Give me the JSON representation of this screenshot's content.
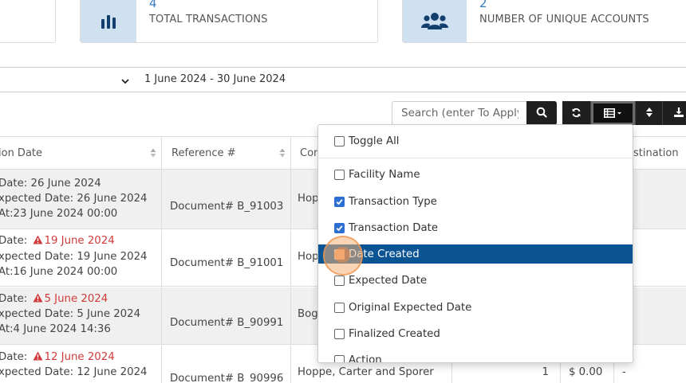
{
  "stats": {
    "transactions": {
      "value": "4",
      "label": "TOTAL TRANSACTIONS",
      "icon": "bar-chart-icon"
    },
    "accounts": {
      "value": "2",
      "label": "NUMBER OF UNIQUE ACCOUNTS",
      "icon": "users-icon"
    }
  },
  "filters": {
    "date_range": "1 June 2024 - 30 June 2024"
  },
  "toolbar": {
    "search_placeholder": "Search (enter To Apply)",
    "icons": [
      "search-icon",
      "refresh-icon",
      "columns-icon",
      "sort-icon",
      "download-icon"
    ]
  },
  "table": {
    "headers": {
      "date": "ion Date",
      "ref": "Reference #",
      "company": "Con",
      "destination": "estination"
    },
    "rows": [
      {
        "line1_prefix": "Date: ",
        "line1_value": "26 June 2024",
        "line1_warn": false,
        "line2": "xpected Date: 26 June 2024",
        "line3": "At:23 June 2024 00:00",
        "ref": "Document# B_91003",
        "company": "Hopp"
      },
      {
        "line1_prefix": "Date: ",
        "line1_value": "19 June 2024",
        "line1_warn": true,
        "line2": "xpected Date: 19 June 2024",
        "line3": "At:16 June 2024 00:00",
        "ref": "Document# B_91001",
        "company": "Hop"
      },
      {
        "line1_prefix": "Date: ",
        "line1_value": "5 June 2024",
        "line1_warn": true,
        "line2": "xpected Date: 5 June 2024",
        "line3": "At:4 June 2024 14:36",
        "ref": "Document# B_90991",
        "company": "Boga"
      },
      {
        "line1_prefix": "Date: ",
        "line1_value": "12 June 2024",
        "line1_warn": true,
        "line2": "xpected Date: 12 June 2024",
        "line3": "",
        "ref": "Document# B_90996",
        "company": "Hoppe, Carter and Sporer",
        "qty": "1",
        "amount": "$ 0.00",
        "destination": "-"
      }
    ]
  },
  "column_menu": {
    "toggle_all": "Toggle All",
    "options": [
      {
        "label": "Facility Name",
        "checked": false
      },
      {
        "label": "Transaction Type",
        "checked": true
      },
      {
        "label": "Transaction Date",
        "checked": true
      },
      {
        "label": "Date Created",
        "checked": false,
        "highlighted": true
      },
      {
        "label": "Expected Date",
        "checked": false
      },
      {
        "label": "Original Expected Date",
        "checked": false
      },
      {
        "label": "Finalized Created",
        "checked": false
      },
      {
        "label": "Action",
        "checked": false
      }
    ]
  },
  "colors": {
    "accent": "#3479c2",
    "highlight": "#0b5494",
    "warning": "#d03a3a",
    "toolbar": "#1f1f1f"
  }
}
